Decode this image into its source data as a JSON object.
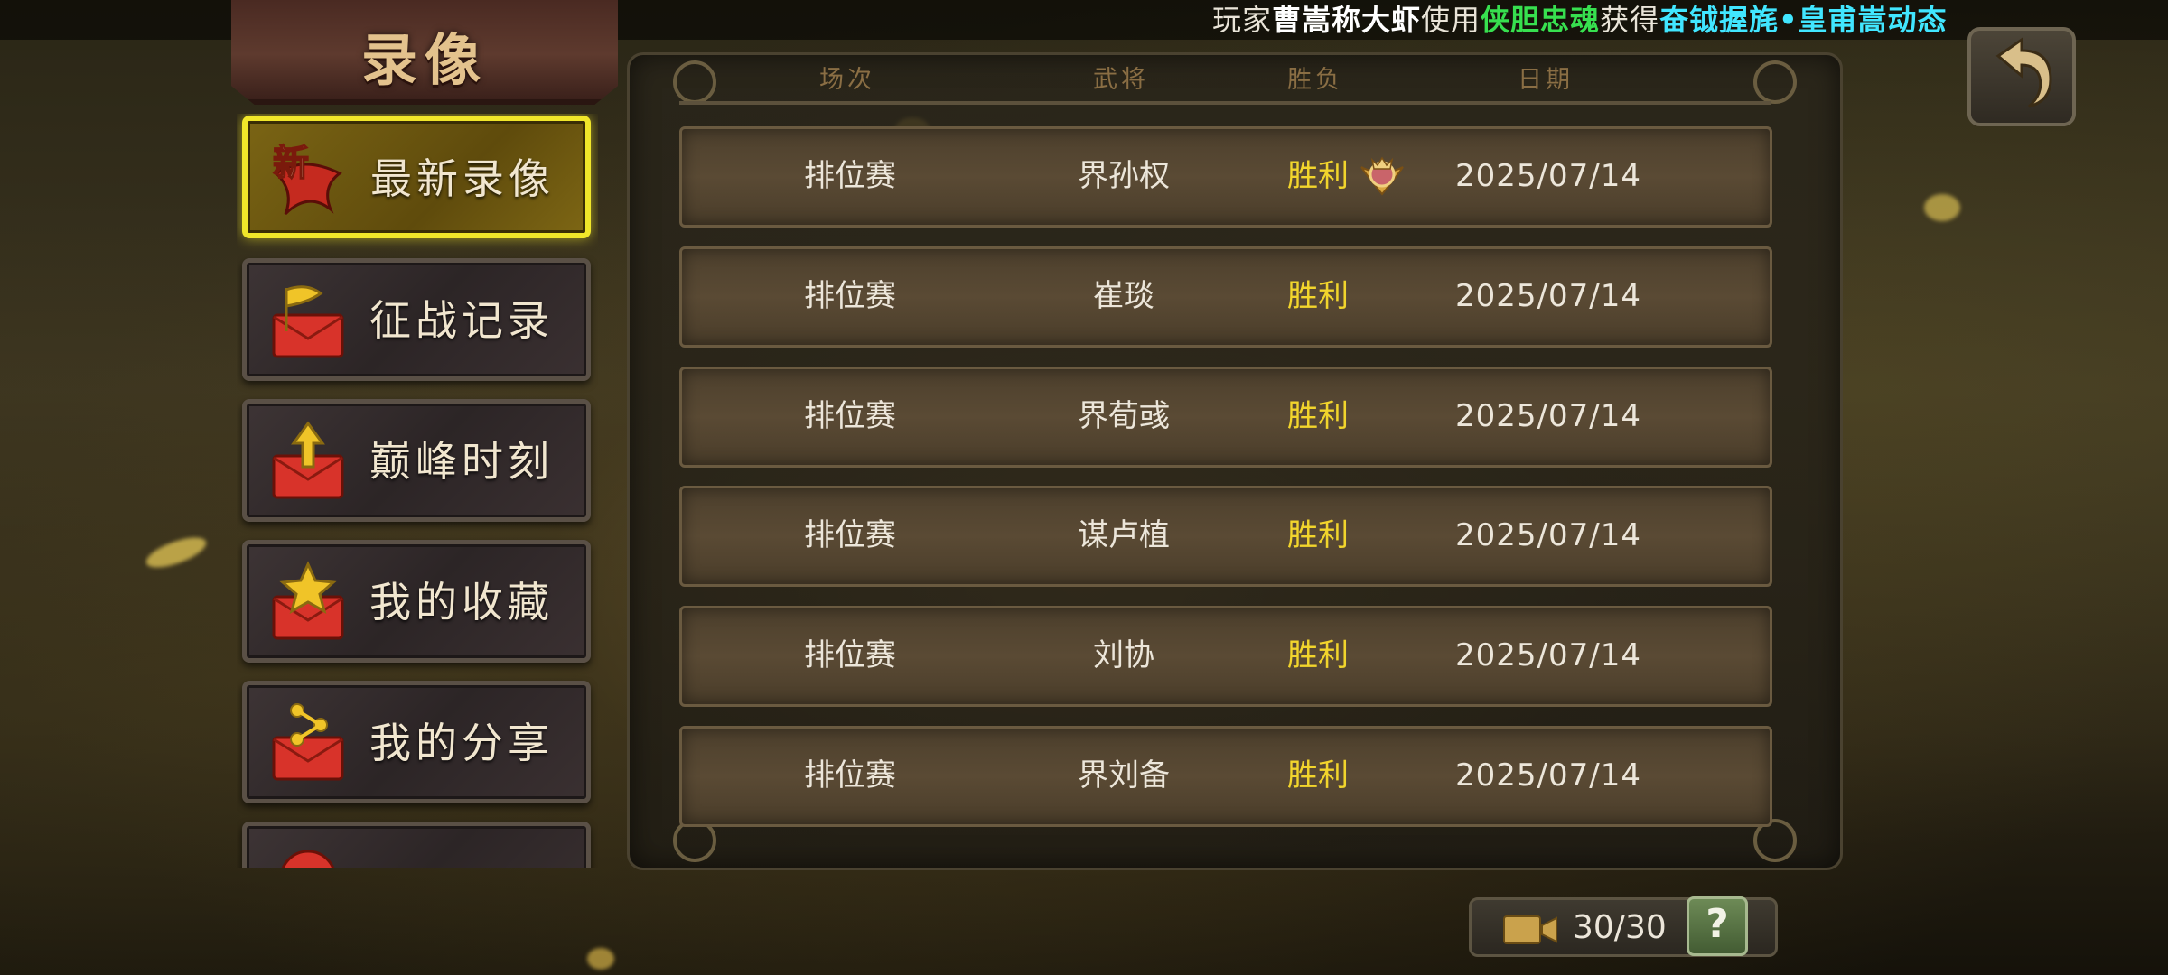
{
  "ticker": {
    "p1": "玩家",
    "player": "曹嵩称大虾",
    "p2": "使用",
    "item": "侠胆忠魂",
    "p3": "获得",
    "reward": "奋钺握旄•皇甫嵩动态"
  },
  "title": "录像",
  "sidebar": {
    "items": [
      {
        "label": "最新录像",
        "badge": "新",
        "icon": "new-ribbon-icon",
        "active": true
      },
      {
        "label": "征战记录",
        "icon": "envelope-flag-icon",
        "active": false
      },
      {
        "label": "巅峰时刻",
        "icon": "envelope-arrow-icon",
        "active": false
      },
      {
        "label": "我的收藏",
        "icon": "envelope-star-icon",
        "active": false
      },
      {
        "label": "我的分享",
        "icon": "envelope-share-icon",
        "active": false
      }
    ]
  },
  "table": {
    "headers": [
      "场次",
      "武将",
      "胜负",
      "日期"
    ],
    "rows": [
      {
        "mode": "排位赛",
        "general": "界孙权",
        "result": "胜利",
        "date": "2025/07/14",
        "medal": true
      },
      {
        "mode": "排位赛",
        "general": "崔琰",
        "result": "胜利",
        "date": "2025/07/14",
        "medal": false
      },
      {
        "mode": "排位赛",
        "general": "界荀彧",
        "result": "胜利",
        "date": "2025/07/14",
        "medal": false
      },
      {
        "mode": "排位赛",
        "general": "谋卢植",
        "result": "胜利",
        "date": "2025/07/14",
        "medal": false
      },
      {
        "mode": "排位赛",
        "general": "刘协",
        "result": "胜利",
        "date": "2025/07/14",
        "medal": false
      },
      {
        "mode": "排位赛",
        "general": "界刘备",
        "result": "胜利",
        "date": "2025/07/14",
        "medal": false
      }
    ]
  },
  "counter": {
    "value": "30/30",
    "help": "?"
  },
  "colors": {
    "win": "#f2d52c",
    "active_border": "#f0e62a",
    "ticker_green": "#37e04f",
    "ticker_cyan": "#41e6ff"
  }
}
